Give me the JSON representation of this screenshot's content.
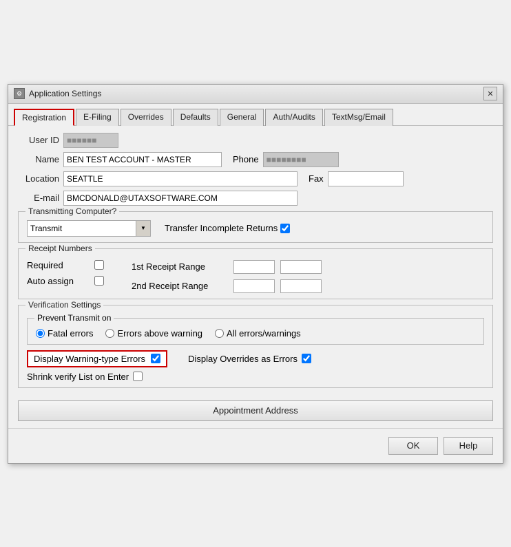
{
  "window": {
    "title": "Application Settings",
    "icon": "⚙"
  },
  "tabs": [
    {
      "label": "Registration",
      "active": true
    },
    {
      "label": "E-Filing",
      "active": false
    },
    {
      "label": "Overrides",
      "active": false
    },
    {
      "label": "Defaults",
      "active": false
    },
    {
      "label": "General",
      "active": false
    },
    {
      "label": "Auth/Audits",
      "active": false
    },
    {
      "label": "TextMsg/Email",
      "active": false
    }
  ],
  "form": {
    "user_id_label": "User ID",
    "name_label": "Name",
    "name_value": "BEN TEST ACCOUNT - MASTER",
    "location_label": "Location",
    "location_value": "SEATTLE",
    "email_label": "E-mail",
    "email_value": "BMCDONALD@UTAXSOFTWARE.COM",
    "phone_label": "Phone",
    "fax_label": "Fax"
  },
  "transmitting": {
    "group_label": "Transmitting Computer?",
    "select_value": "Transmit",
    "select_options": [
      "Transmit"
    ],
    "transfer_label": "Transfer Incomplete Returns",
    "transfer_checked": true
  },
  "receipt_numbers": {
    "group_label": "Receipt Numbers",
    "required_label": "Required",
    "required_checked": false,
    "auto_assign_label": "Auto assign",
    "auto_assign_checked": false,
    "first_range_label": "1st Receipt Range",
    "second_range_label": "2nd Receipt Range"
  },
  "verification": {
    "group_label": "Verification Settings",
    "prevent_label": "Prevent Transmit on",
    "fatal_errors_label": "Fatal errors",
    "errors_above_label": "Errors above warning",
    "all_errors_label": "All errors/warnings",
    "display_warning_label": "Display Warning-type Errors",
    "display_warning_checked": true,
    "display_overrides_label": "Display Overrides as Errors",
    "display_overrides_checked": true,
    "shrink_verify_label": "Shrink verify List on Enter",
    "shrink_verify_checked": false
  },
  "buttons": {
    "appointment_address": "Appointment Address",
    "ok": "OK",
    "help": "Help"
  }
}
